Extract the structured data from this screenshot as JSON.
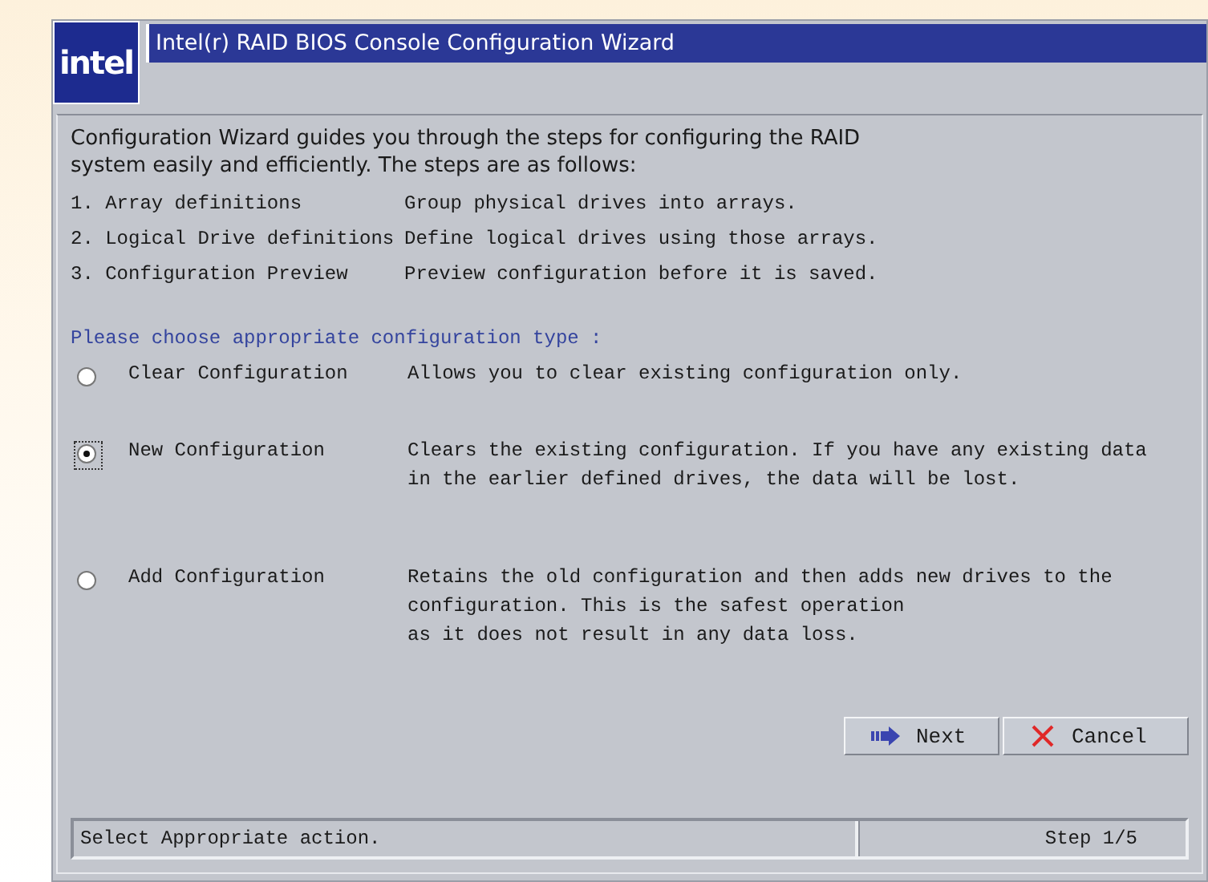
{
  "window": {
    "logo": "intel",
    "title": "Intel(r) RAID BIOS Console Configuration Wizard"
  },
  "intro": [
    "Configuration Wizard guides you through the steps for configuring the RAID",
    "system easily and efficiently. The steps are as follows:"
  ],
  "steps": [
    {
      "name": "1. Array definitions",
      "description": "Group physical drives into arrays."
    },
    {
      "name": "2. Logical Drive definitions",
      "description": "Define logical drives using those arrays."
    },
    {
      "name": "3. Configuration Preview",
      "description": "Preview configuration before it is saved."
    }
  ],
  "prompt": "Please choose appropriate configuration type :",
  "options": [
    {
      "label": "Clear Configuration",
      "selected": false,
      "description": [
        "Allows you to clear existing configuration only."
      ]
    },
    {
      "label": "New Configuration",
      "selected": true,
      "description": [
        "Clears the existing configuration. If you have any existing data",
        "in the earlier defined drives, the data will be lost."
      ]
    },
    {
      "label": "Add Configuration",
      "selected": false,
      "description": [
        "Retains the old configuration and then adds new drives to the",
        "configuration. This is the safest operation",
        "as it does not result in any data loss."
      ]
    }
  ],
  "buttons": [
    {
      "kind": "next",
      "label": "Next"
    },
    {
      "kind": "cancel",
      "label": "Cancel"
    }
  ],
  "status_bar": {
    "message": "Select Appropriate action.",
    "step": "Step 1/5"
  }
}
